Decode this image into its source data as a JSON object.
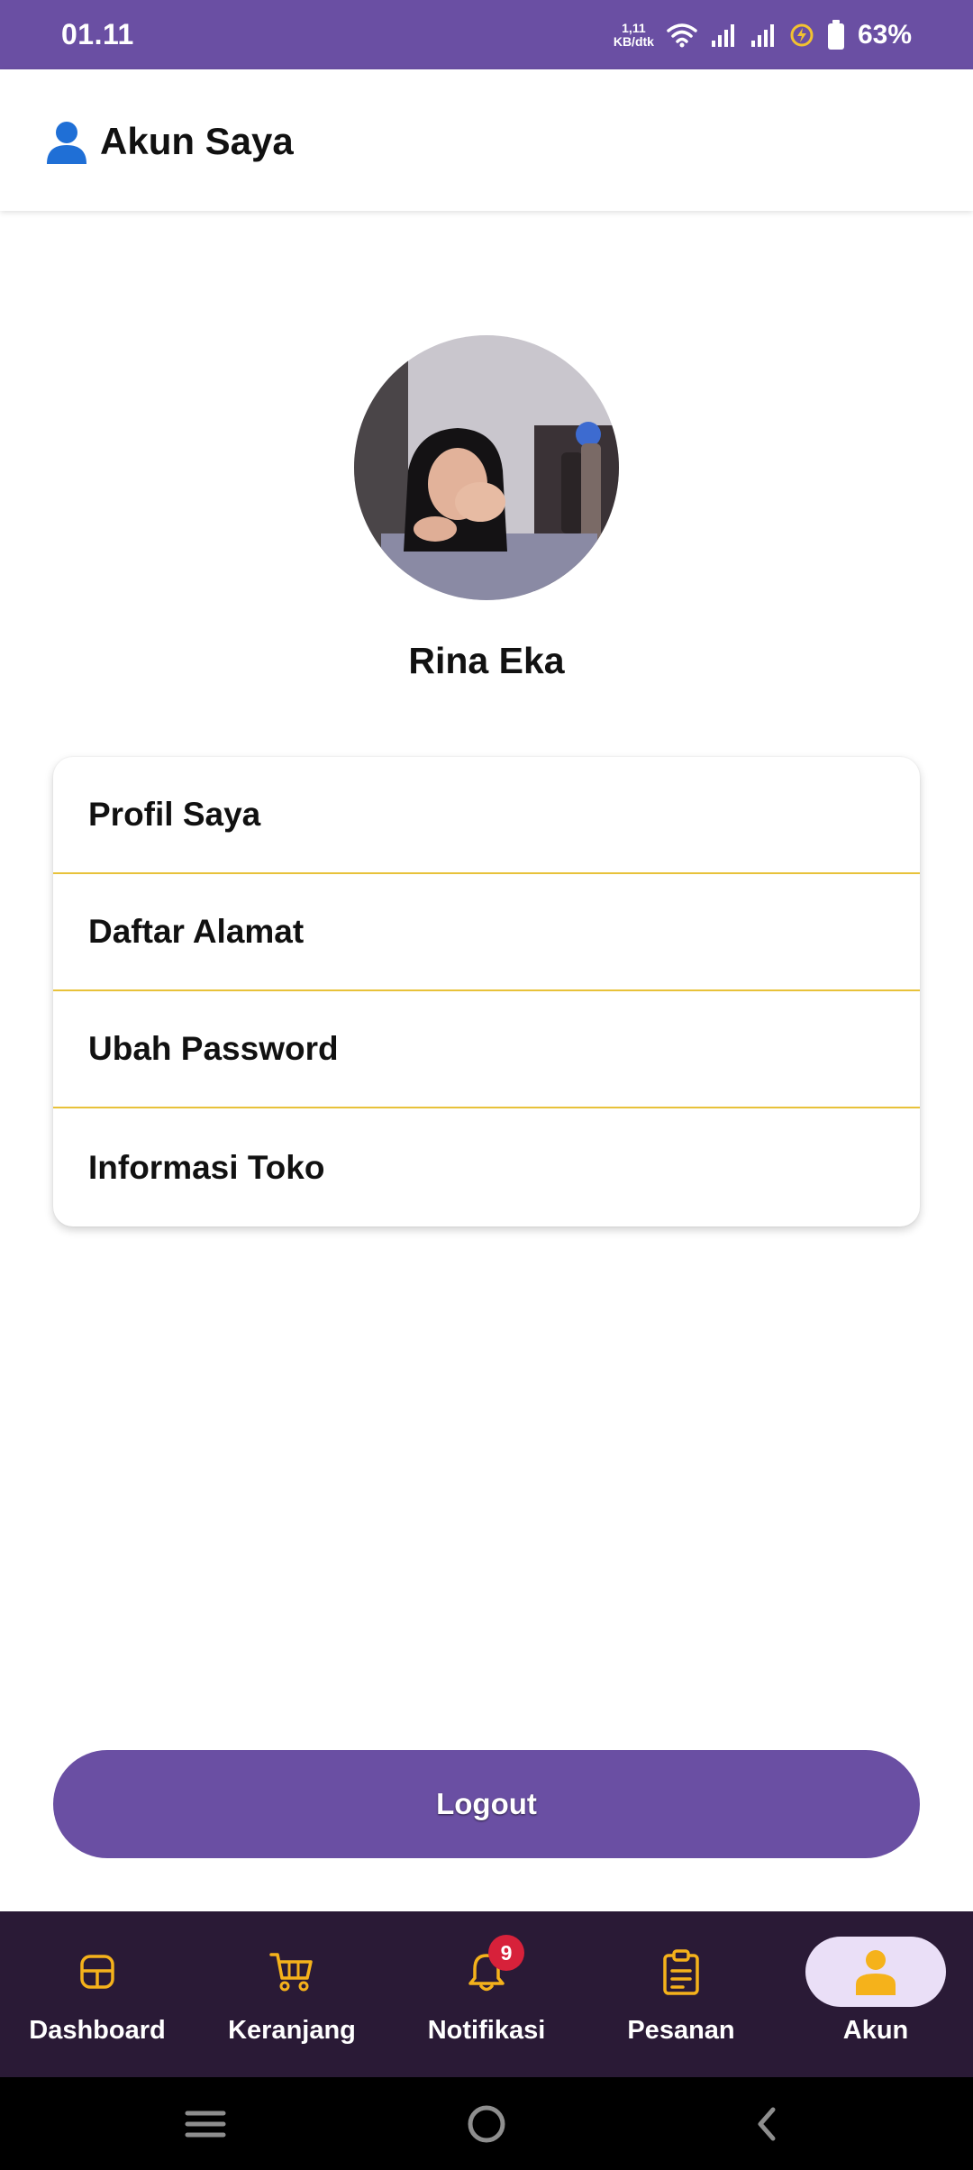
{
  "status_bar": {
    "time": "01.11",
    "net_speed_value": "1,11",
    "net_speed_unit": "KB/dtk",
    "battery_percent": "63%"
  },
  "app_bar": {
    "icon": "user-icon",
    "title": "Akun Saya"
  },
  "profile": {
    "name": "Rina Eka"
  },
  "menu": {
    "items": [
      {
        "label": "Profil Saya"
      },
      {
        "label": "Daftar Alamat"
      },
      {
        "label": "Ubah Password"
      },
      {
        "label": "Informasi Toko"
      }
    ]
  },
  "logout": {
    "label": "Logout"
  },
  "bottom_nav": {
    "items": [
      {
        "label": "Dashboard",
        "icon": "dashboard-icon"
      },
      {
        "label": "Keranjang",
        "icon": "cart-icon"
      },
      {
        "label": "Notifikasi",
        "icon": "bell-icon",
        "badge": "9"
      },
      {
        "label": "Pesanan",
        "icon": "clipboard-icon"
      },
      {
        "label": "Akun",
        "icon": "person-icon",
        "active": true
      }
    ]
  },
  "colors": {
    "primary": "#6a4fa3",
    "accent": "#f5b21b",
    "divider": "#e8c23a",
    "nav_background": "#2a1a36",
    "badge": "#d7213a"
  }
}
